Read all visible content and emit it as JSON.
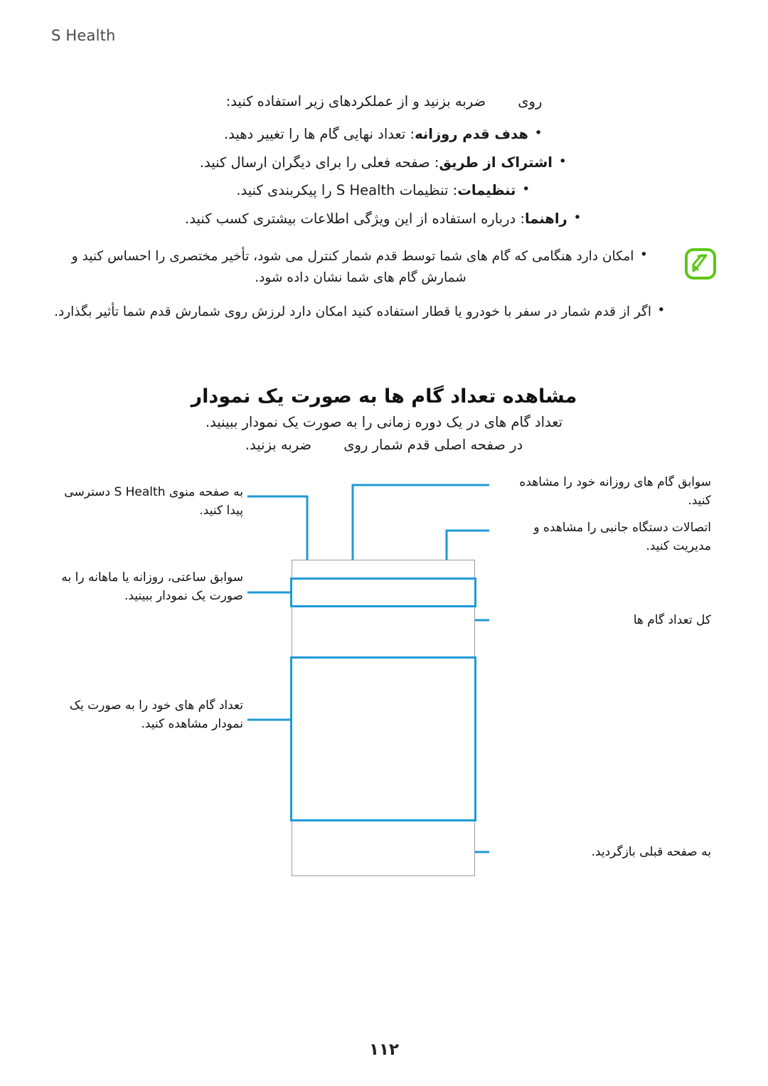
{
  "header": {
    "title": "S Health"
  },
  "body": {
    "intro": "روی   ضربه بزنید و از عملکردهای زیر استفاده کنید:",
    "bullets": [
      {
        "term": "هدف قدم روزانه",
        "text": ": تعداد نهایی گام ها را تغییر دهید."
      },
      {
        "term": "اشتراک از طریق",
        "text": ": صفحه فعلی را برای دیگران ارسال کنید."
      },
      {
        "term": "تنظیمات",
        "text": ": تنظیمات S Health را پیکربندی کنید."
      },
      {
        "term": "راهنما",
        "text": ": درباره استفاده از این ویژگی اطلاعات بیشتری کسب کنید."
      }
    ]
  },
  "note": {
    "icon": "note-pencil-icon",
    "icon_color": "#5cc717",
    "items": [
      "امکان دارد هنگامی که گام های شما توسط قدم شمار کنترل می شود، تأخیر مختصری را احساس کنید و شمارش گام های شما نشان داده شود.",
      "اگر از قدم شمار در سفر با خودرو یا قطار استفاده کنید امکان دارد لرزش روی شمارش قدم شما تأثیر بگذارد."
    ]
  },
  "section": {
    "heading": "مشاهده تعداد گام ها به صورت یک نمودار",
    "intro_line_1": "تعداد گام های در یک دوره زمانی را به صورت یک نمودار ببینید.",
    "intro_line_2": "در صفحه اصلی قدم شمار روی   ضربه بزنید."
  },
  "figure": {
    "accent_color": "#1f9ad6",
    "frame_color": "#9b9b9b",
    "annotations": {
      "left_top": "به صفحه منوی S Health دسترسی پیدا کنید.",
      "left_mid": "سوابق ساعتی، روزانه یا ماهانه را به صورت یک نمودار ببینید.",
      "left_bottom": "تعداد گام های خود را به صورت یک نمودار مشاهده کنید.",
      "right_top": "سوابق گام های روزانه خود را مشاهده کنید.",
      "right_second": "اتصالات دستگاه جانبی را مشاهده و مدیریت کنید.",
      "right_mid": "کل تعداد گام ها",
      "right_bottom": "به صفحه قبلی بازگردید."
    }
  },
  "footer": {
    "page_number": "۱۱۲"
  }
}
